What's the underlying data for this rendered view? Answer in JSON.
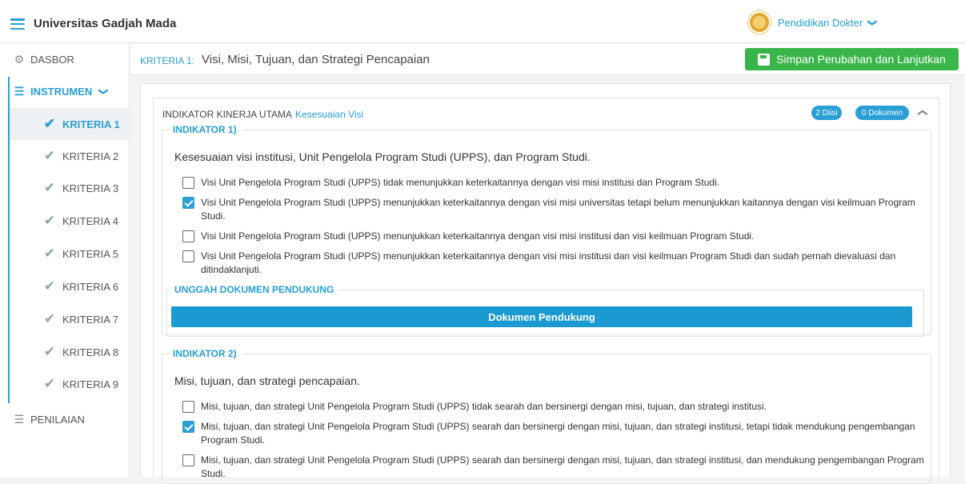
{
  "topbar": {
    "app_title": "Universitas Gadjah Mada",
    "user_name": "Pendidikan Dokter",
    "user_chevron": "❯"
  },
  "sidebar": {
    "dasbor": "DASBOR",
    "instrumen": "INSTRUMEN",
    "penilaian": "PENILAIAN",
    "kriteria": [
      "KRITERIA 1",
      "KRITERIA 2",
      "KRITERIA 3",
      "KRITERIA 4",
      "KRITERIA 5",
      "KRITERIA 6",
      "KRITERIA 7",
      "KRITERIA 8",
      "KRITERIA 9"
    ]
  },
  "header": {
    "criteria_prefix": "KRITERIA 1:",
    "criteria_title": "Visi, Misi, Tujuan, dan Strategi Pencapaian",
    "save_label": "Simpan Perubahan dan Lanjutkan"
  },
  "iku": {
    "label": "INDIKATOR KINERJA UTAMA",
    "name": "Kesesuaian Visi",
    "filled_badge": "2 Diisi",
    "docs_badge": "0 Dokumen"
  },
  "indicators": [
    {
      "legend": "INDIKATOR 1)",
      "question": "Kesesuaian visi institusi, Unit Pengelola Program Studi (UPPS), dan Program Studi.",
      "options": [
        {
          "text": "Visi Unit Pengelola Program Studi (UPPS) tidak menunjukkan keterkaitannya dengan visi misi institusi dan Program Studi.",
          "checked": false
        },
        {
          "text": "Visi Unit Pengelola Program Studi (UPPS) menunjukkan keterkaitannya dengan visi misi universitas tetapi belum menunjukkan kaitannya dengan visi keilmuan Program Studi.",
          "checked": true
        },
        {
          "text": "Visi Unit Pengelola Program Studi (UPPS) menunjukkan keterkaitannya dengan visi misi institusi dan visi keilmuan Program Studi.",
          "checked": false
        },
        {
          "text": "Visi Unit Pengelola Program Studi (UPPS) menunjukkan keterkaitannya dengan visi misi institusi dan visi keilmuan Program Studi dan sudah pernah dievaluasi dan ditindaklanjuti.",
          "checked": false
        }
      ],
      "upload_legend": "UNGGAH DOKUMEN PENDUKUNG",
      "upload_button": "Dokumen Pendukung"
    },
    {
      "legend": "INDIKATOR 2)",
      "question": "Misi, tujuan, dan strategi pencapaian.",
      "options": [
        {
          "text": "Misi, tujuan, dan strategi Unit Pengelola Program Studi (UPPS) tidak searah dan bersinergi dengan misi, tujuan, dan strategi institusi.",
          "checked": false
        },
        {
          "text": "Misi, tujuan, dan strategi Unit Pengelola Program Studi (UPPS) searah dan bersinergi dengan misi, tujuan, dan strategi institusi, tetapi tidak mendukung pengembangan Program Studi.",
          "checked": true
        },
        {
          "text": "Misi, tujuan, dan strategi Unit Pengelola Program Studi (UPPS) searah dan bersinergi dengan misi, tujuan, dan strategi institusi, dan mendukung pengembangan Program Studi.",
          "checked": false
        }
      ]
    }
  ],
  "colors": {
    "accent": "#2a9fd6",
    "save_green": "#3ab54a"
  }
}
